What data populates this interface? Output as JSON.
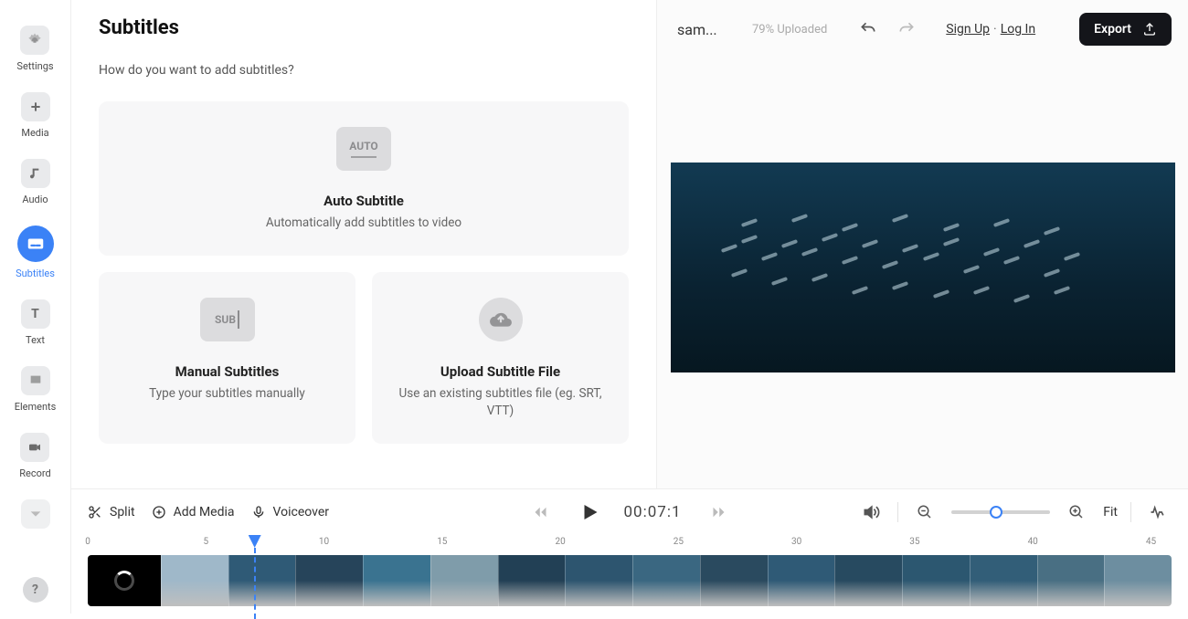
{
  "sidebar": {
    "items": [
      {
        "id": "settings",
        "label": "Settings"
      },
      {
        "id": "media",
        "label": "Media"
      },
      {
        "id": "audio",
        "label": "Audio"
      },
      {
        "id": "subtitles",
        "label": "Subtitles"
      },
      {
        "id": "text",
        "label": "Text"
      },
      {
        "id": "elements",
        "label": "Elements"
      },
      {
        "id": "record",
        "label": "Record"
      }
    ]
  },
  "panel": {
    "title": "Subtitles",
    "question": "How do you want to add subtitles?",
    "auto": {
      "icon_text": "AUTO",
      "title": "Auto Subtitle",
      "desc": "Automatically add subtitles to video"
    },
    "manual": {
      "icon_text": "SUB",
      "title": "Manual Subtitles",
      "desc": "Type your subtitles manually"
    },
    "upload": {
      "title": "Upload Subtitle File",
      "desc": "Use an existing subtitles file (eg. SRT, VTT)"
    }
  },
  "topbar": {
    "project_name": "sam...",
    "upload_status": "79% Uploaded",
    "signup": "Sign Up",
    "login": "Log In",
    "export": "Export"
  },
  "toolbar": {
    "split": "Split",
    "add_media": "Add Media",
    "voiceover": "Voiceover",
    "timecode": "00:07:1",
    "fit": "Fit",
    "zoom_position_pct": 45
  },
  "ruler": {
    "ticks": [
      {
        "label": "0",
        "pct": 0
      },
      {
        "label": "5",
        "pct": 10.9
      },
      {
        "label": "10",
        "pct": 21.8
      },
      {
        "label": "15",
        "pct": 32.7
      },
      {
        "label": "20",
        "pct": 43.6
      },
      {
        "label": "25",
        "pct": 54.5
      },
      {
        "label": "30",
        "pct": 65.4
      },
      {
        "label": "35",
        "pct": 76.3
      },
      {
        "label": "40",
        "pct": 87.2
      },
      {
        "label": "45",
        "pct": 98.1
      }
    ],
    "playhead_pct": 15.4
  },
  "track": {
    "thumb_colors": [
      "#9fb8c9",
      "#2f5a76",
      "#26445a",
      "#3a7390",
      "#7f9caa",
      "#224055",
      "#2d556f",
      "#3a6781",
      "#2a4a5f",
      "#2f5a76",
      "#274a60",
      "#2c5770",
      "#325e78",
      "#496f83",
      "#6d8ea0"
    ]
  },
  "preview": {
    "fish_spots": [
      [
        10,
        40
      ],
      [
        14,
        36
      ],
      [
        18,
        44
      ],
      [
        22,
        38
      ],
      [
        26,
        42
      ],
      [
        30,
        35
      ],
      [
        34,
        46
      ],
      [
        38,
        38
      ],
      [
        42,
        48
      ],
      [
        46,
        40
      ],
      [
        50,
        44
      ],
      [
        54,
        37
      ],
      [
        58,
        50
      ],
      [
        62,
        42
      ],
      [
        66,
        46
      ],
      [
        70,
        38
      ],
      [
        74,
        52
      ],
      [
        78,
        44
      ],
      [
        12,
        52
      ],
      [
        20,
        56
      ],
      [
        28,
        54
      ],
      [
        36,
        60
      ],
      [
        44,
        58
      ],
      [
        52,
        62
      ],
      [
        60,
        60
      ],
      [
        68,
        64
      ],
      [
        76,
        60
      ],
      [
        14,
        28
      ],
      [
        24,
        26
      ],
      [
        34,
        30
      ],
      [
        44,
        26
      ],
      [
        54,
        30
      ],
      [
        64,
        28
      ],
      [
        74,
        32
      ]
    ]
  }
}
